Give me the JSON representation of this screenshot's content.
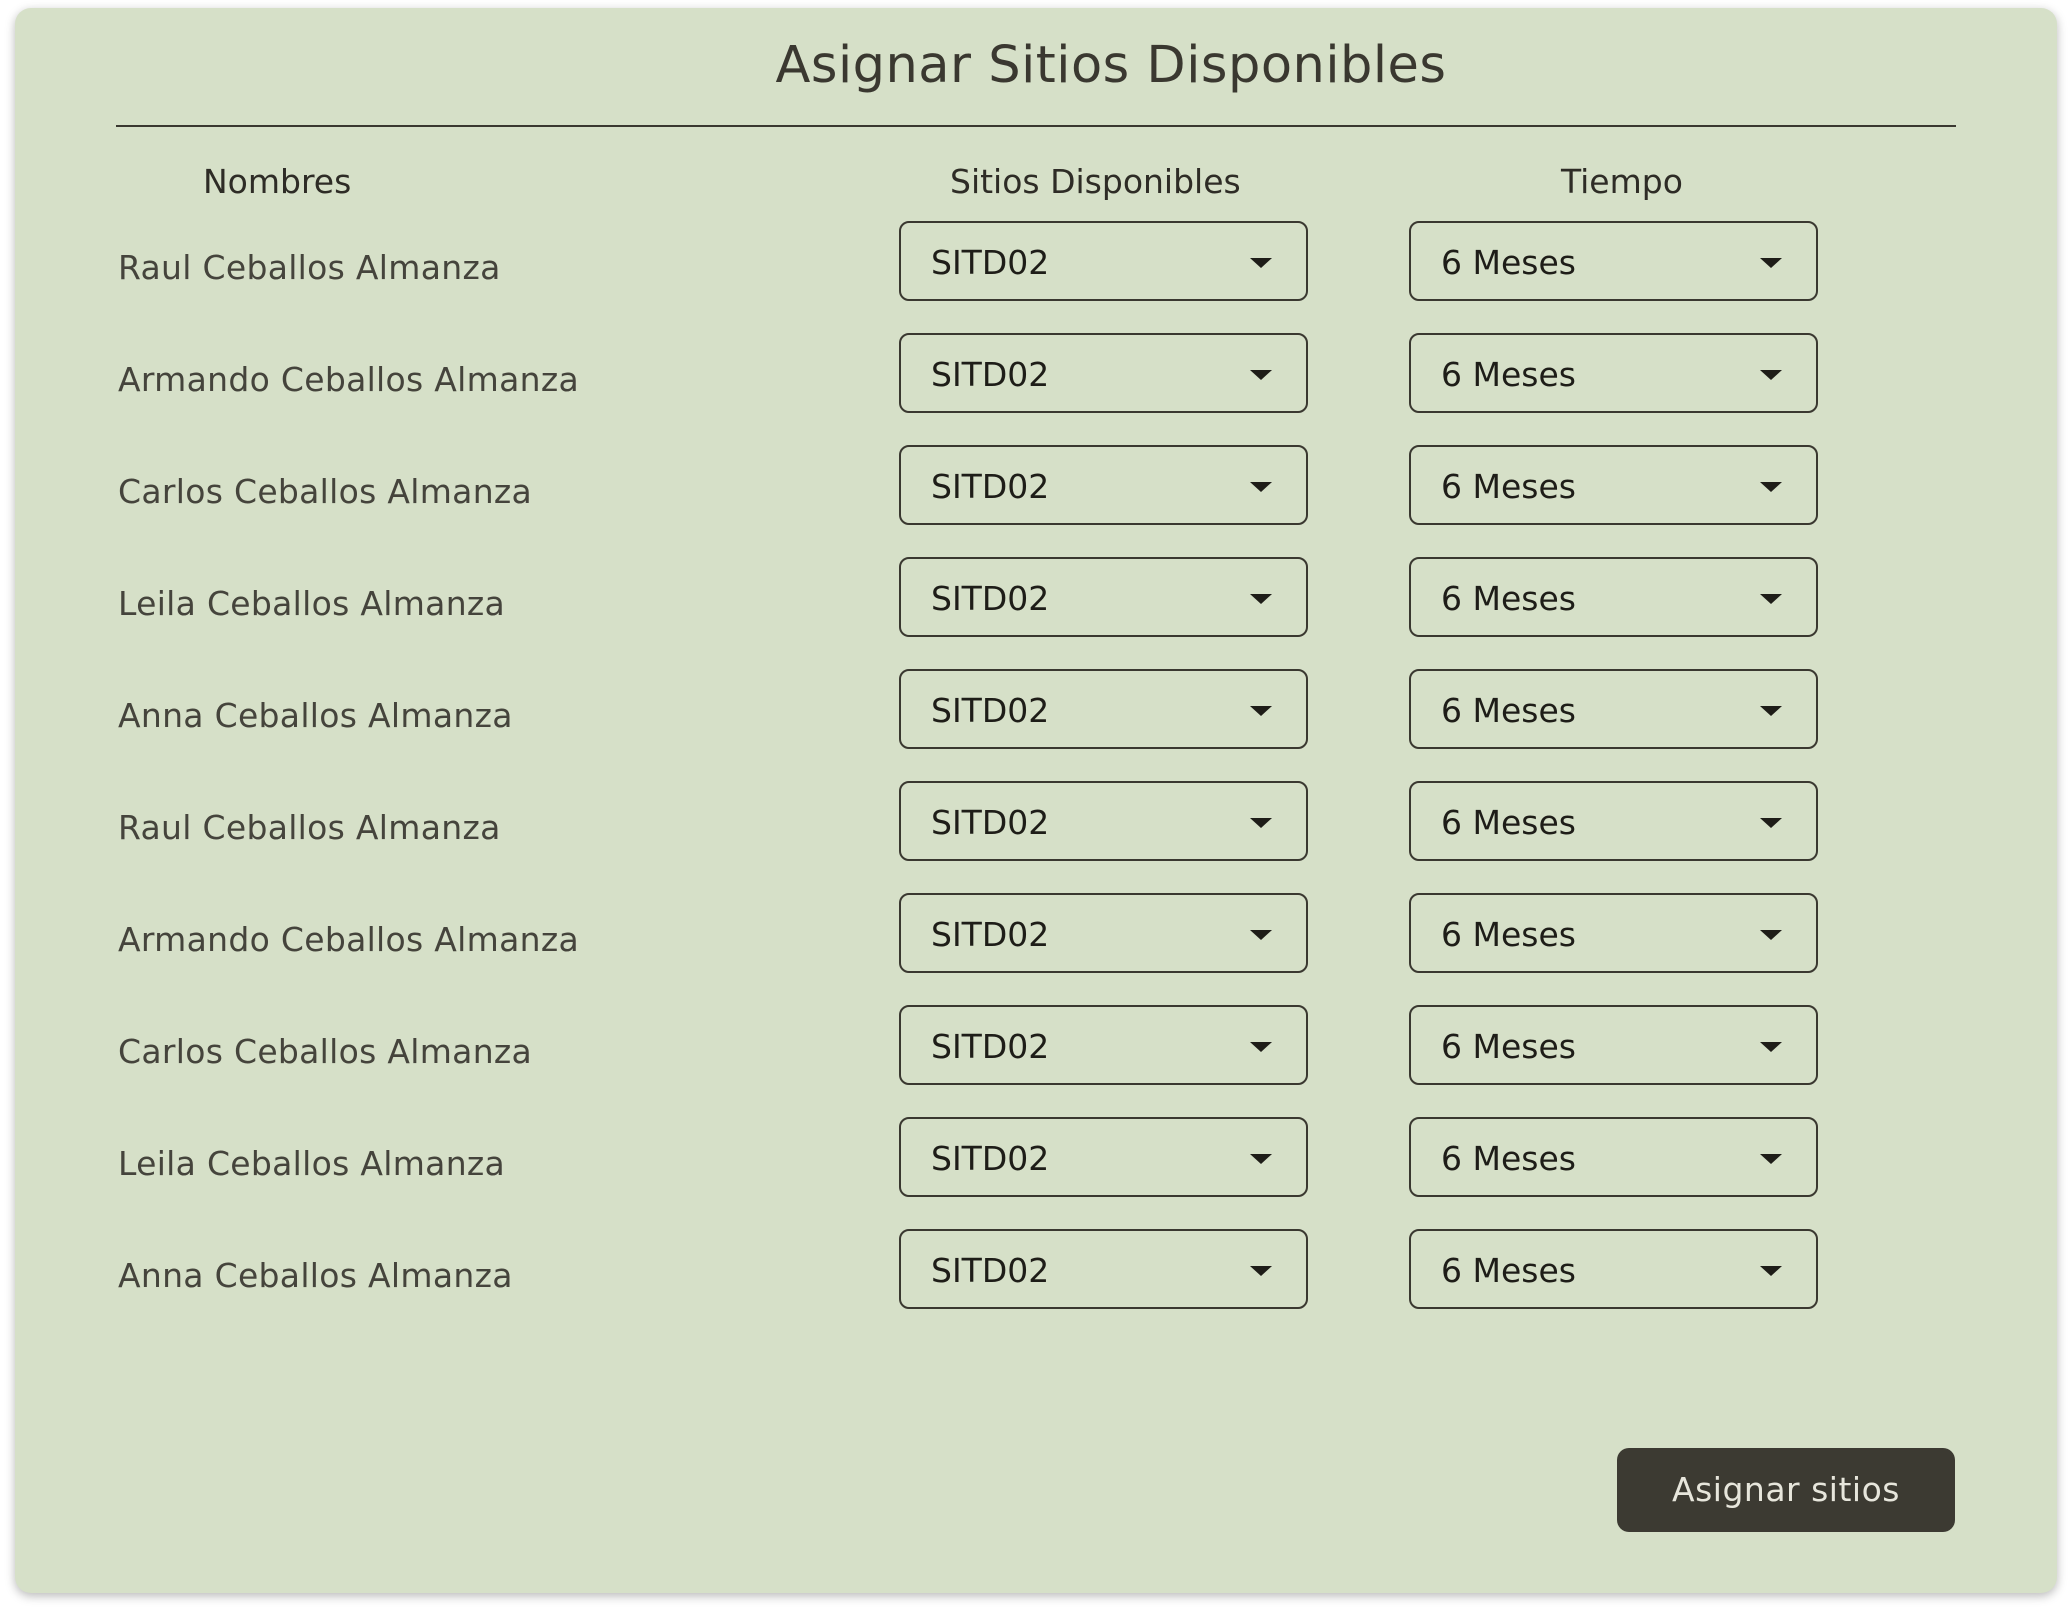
{
  "title": "Asignar Sitios Disponibles",
  "columns": {
    "names": "Nombres",
    "sitios": "Sitios Disponibles",
    "tiempo": "Tiempo"
  },
  "rows": [
    {
      "name": "Raul Ceballos Almanza",
      "sitio": "SITD02",
      "tiempo": "6 Meses"
    },
    {
      "name": "Armando Ceballos Almanza",
      "sitio": "SITD02",
      "tiempo": "6 Meses"
    },
    {
      "name": "Carlos Ceballos Almanza",
      "sitio": "SITD02",
      "tiempo": "6 Meses"
    },
    {
      "name": "Leila Ceballos Almanza",
      "sitio": "SITD02",
      "tiempo": "6 Meses"
    },
    {
      "name": "Anna Ceballos Almanza",
      "sitio": "SITD02",
      "tiempo": "6 Meses"
    },
    {
      "name": "Raul Ceballos Almanza",
      "sitio": "SITD02",
      "tiempo": "6 Meses"
    },
    {
      "name": "Armando Ceballos Almanza",
      "sitio": "SITD02",
      "tiempo": "6 Meses"
    },
    {
      "name": "Carlos Ceballos Almanza",
      "sitio": "SITD02",
      "tiempo": "6 Meses"
    },
    {
      "name": "Leila Ceballos Almanza",
      "sitio": "SITD02",
      "tiempo": "6 Meses"
    },
    {
      "name": "Anna Ceballos Almanza",
      "sitio": "SITD02",
      "tiempo": "6 Meses"
    }
  ],
  "submit_label": "Asignar sitios",
  "icons": {
    "dropdown": "caret-down-icon"
  },
  "colors": {
    "card_background": "#d6e0c8",
    "button_background": "#3c3a32",
    "text": "#3a3830"
  }
}
